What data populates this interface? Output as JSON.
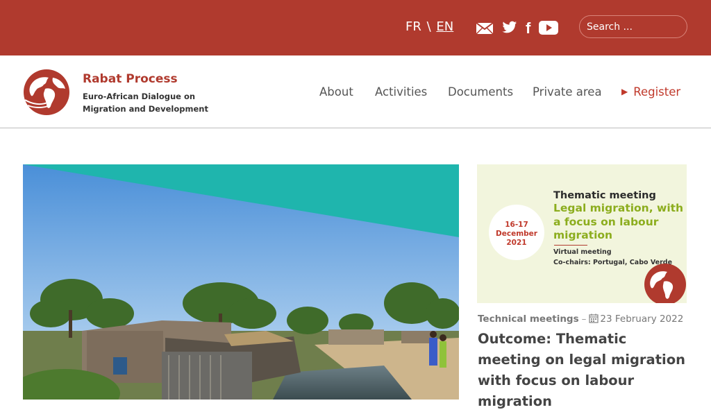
{
  "topbar": {
    "lang_fr": "FR",
    "lang_sep": "\\",
    "lang_en": "EN",
    "icons": [
      "mail-icon",
      "twitter-icon",
      "facebook-icon",
      "youtube-icon"
    ],
    "search_placeholder": "Search ...",
    "background_color": "#b03a2e"
  },
  "brand": {
    "title": "Rabat Process",
    "subtitle": "Euro-African Dialogue on Migration and Development"
  },
  "nav": {
    "about": "About",
    "activities": "Activities",
    "documents": "Documents",
    "private_area": "Private area",
    "register": "Register"
  },
  "feature_image": {
    "line1": "Thematic meeting",
    "line2": "Legal migration, with a focus on labour migration",
    "date": "16-17 December 2021",
    "details": "Virtual meeting\nCo-chairs: Portugal, Cabo Verde"
  },
  "article": {
    "category": "Technical meetings",
    "date": "23 February 2022",
    "title": "Outcome: Thematic meeting on legal migration with focus on labour migration"
  }
}
